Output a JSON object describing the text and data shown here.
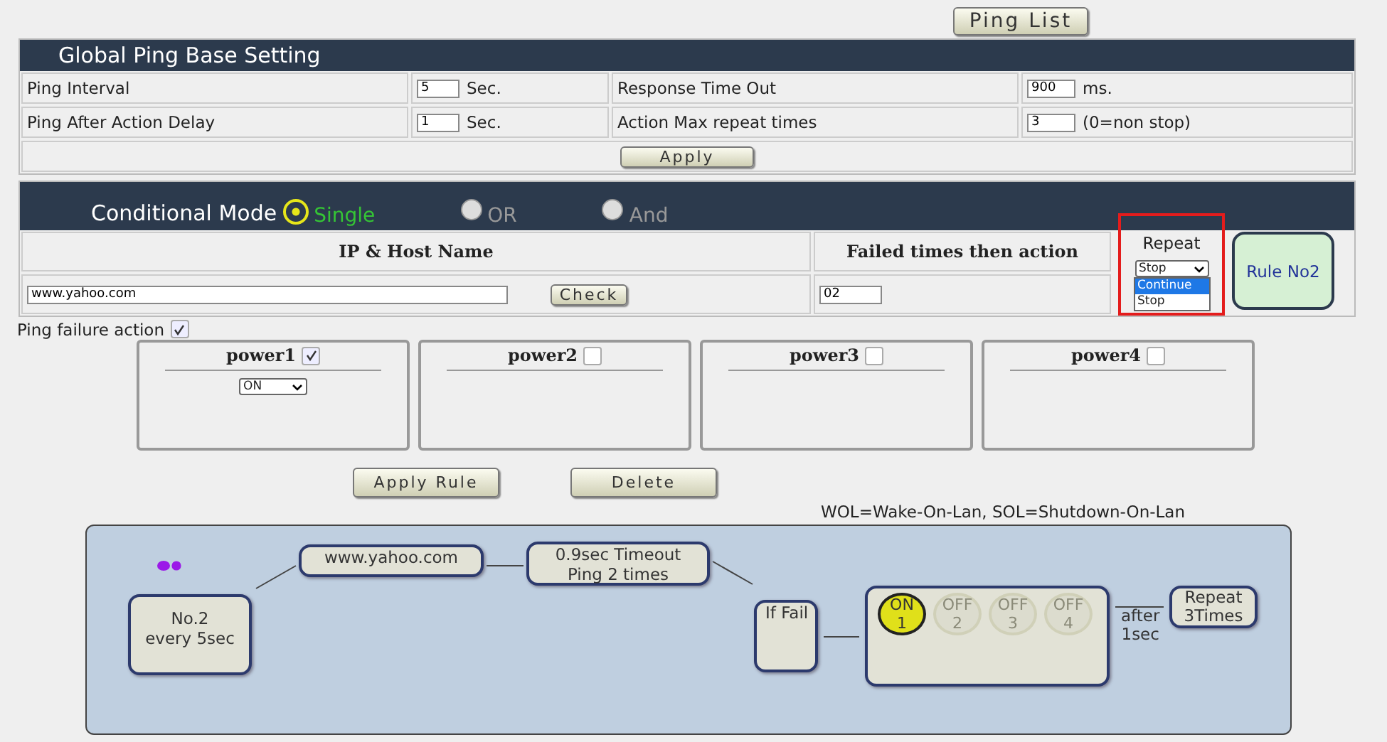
{
  "ping_list_button": "Ping List",
  "global": {
    "title": "Global Ping Base Setting",
    "rows": [
      {
        "label": "Ping Interval",
        "value": "5",
        "unit": "Sec.",
        "label_2": "Response Time Out",
        "value_2": "900",
        "unit_2": "ms."
      },
      {
        "label": "Ping After Action Delay",
        "value": "1",
        "unit": "Sec.",
        "label_2": "Action Max repeat times",
        "value_2": "3",
        "unit_2": "(0=non stop)"
      }
    ],
    "apply": "Apply"
  },
  "conditional": {
    "title": "Conditional Mode",
    "modes": [
      {
        "label": "Single",
        "selected": true
      },
      {
        "label": "OR",
        "selected": false
      },
      {
        "label": "And",
        "selected": false
      }
    ],
    "columns": [
      "IP & Host Name",
      "Failed times then action",
      "Repeat"
    ],
    "host": "www.yahoo.com",
    "check": "Check",
    "failed_times": "02",
    "repeat_highlighted": true,
    "repeat_value": "Stop",
    "repeat_options": [
      {
        "label": "Continue",
        "selected": true
      },
      {
        "label": "Stop",
        "selected": false
      }
    ],
    "rule_button": "Rule No2"
  },
  "ping_failure_action": {
    "label": "Ping failure action",
    "checked": true
  },
  "powers": [
    {
      "name": "power1",
      "checked": true,
      "action": "ON"
    },
    {
      "name": "power2",
      "checked": false
    },
    {
      "name": "power3",
      "checked": false
    },
    {
      "name": "power4",
      "checked": false
    }
  ],
  "buttons": [
    "Apply Rule",
    "Delete"
  ],
  "legend": "WOL=Wake-On-Lan, SOL=Shutdown-On-Lan",
  "diagram": {
    "rule": "No.2\nevery 5sec",
    "host": "www.yahoo.com",
    "timeout": "0.9sec Timeout\nPing 2 times",
    "if_fail": "If Fail",
    "outlets": [
      {
        "state": "ON",
        "number": "1",
        "on": true
      },
      {
        "state": "OFF",
        "number": "2",
        "on": false
      },
      {
        "state": "OFF",
        "number": "3",
        "on": false
      },
      {
        "state": "OFF",
        "number": "4",
        "on": false
      }
    ],
    "delay": "after\n1sec",
    "repeat": "Repeat\n3Times"
  }
}
